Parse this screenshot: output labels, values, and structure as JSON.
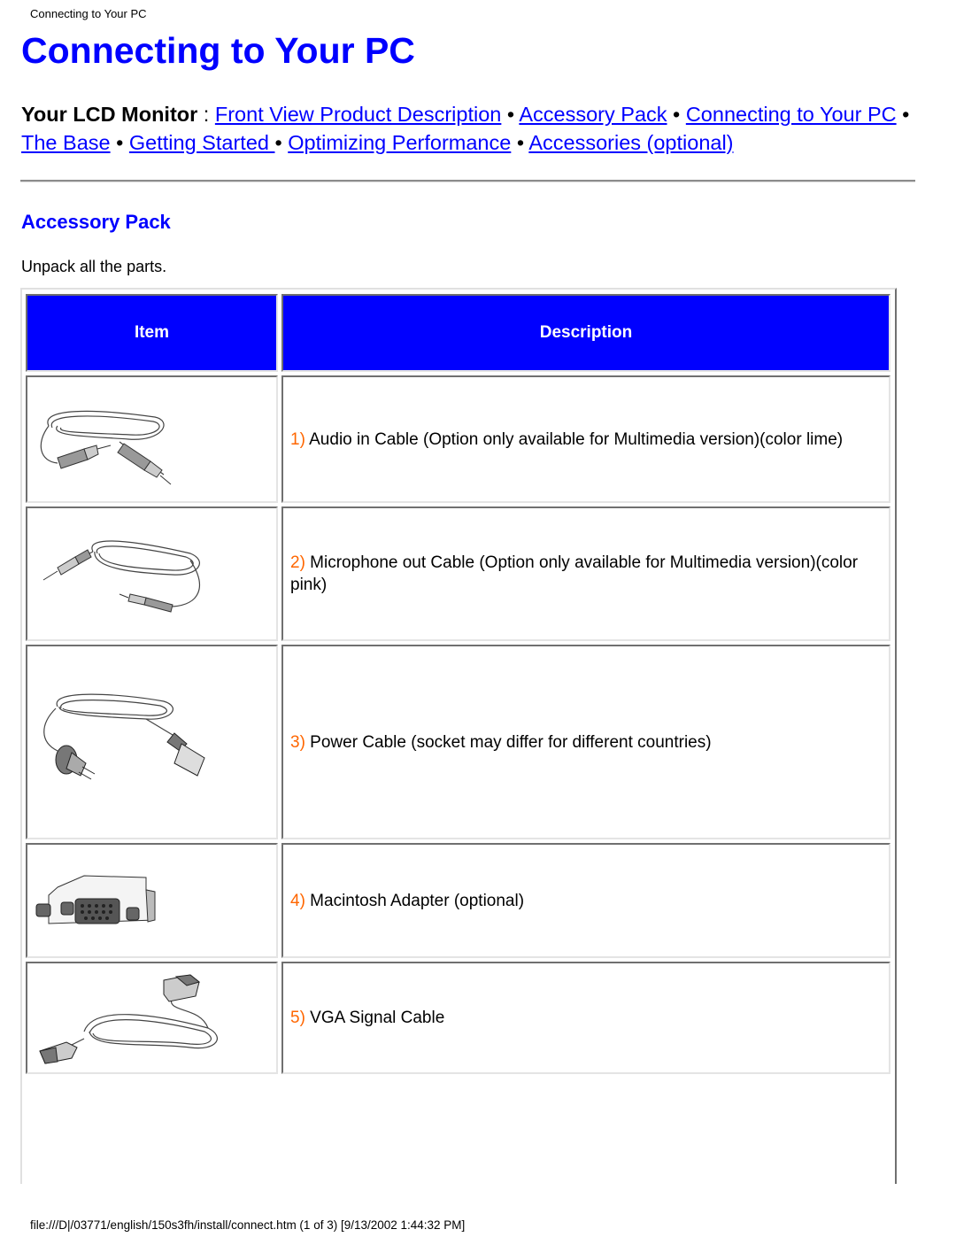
{
  "running_header": "Connecting to Your PC",
  "page_title": "Connecting to Your PC",
  "nav": {
    "lead": "Your LCD Monitor",
    "separator": " : ",
    "bullet": " • ",
    "links": [
      "Front View Product Description",
      "Accessory Pack",
      "Connecting to Your PC",
      "The Base",
      "Getting Started ",
      "Optimizing Performance",
      "Accessories (optional)"
    ]
  },
  "section_title": "Accessory Pack",
  "intro": "Unpack all the parts.",
  "table": {
    "headers": {
      "item": "Item",
      "description": "Description"
    },
    "header_color": "#0000ff",
    "number_color": "#ff6600",
    "rows": [
      {
        "number": "1)",
        "text": " Audio in Cable (Option only available for Multimedia version)(color lime)",
        "image": "audio-cable-icon"
      },
      {
        "number": "2)",
        "text": " Microphone out Cable (Option only available for Multimedia version)(color pink)",
        "image": "microphone-cable-icon"
      },
      {
        "number": "3)",
        "text": " Power Cable (socket may differ for different countries)",
        "image": "power-cable-icon"
      },
      {
        "number": "4)",
        "text": " Macintosh Adapter (optional)",
        "image": "mac-adapter-icon"
      },
      {
        "number": "5)",
        "text": " VGA Signal Cable",
        "image": "vga-cable-icon"
      }
    ]
  },
  "footer": "file:///D|/03771/english/150s3fh/install/connect.htm (1 of 3) [9/13/2002 1:44:32 PM]"
}
